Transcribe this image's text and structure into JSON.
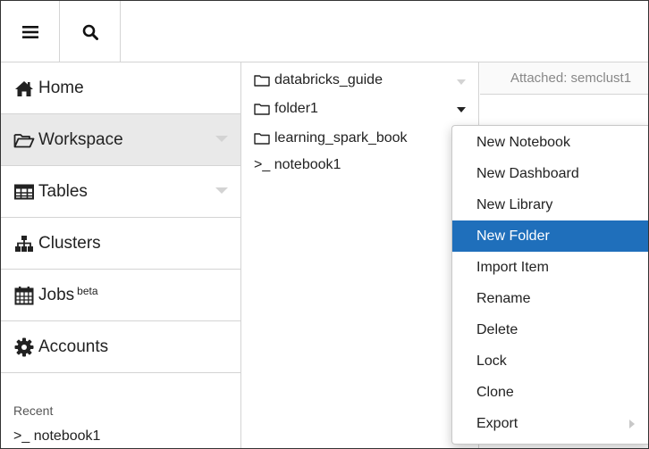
{
  "sidebar": {
    "items": [
      {
        "label": "Home",
        "icon": "home-icon"
      },
      {
        "label": "Workspace",
        "icon": "folder-open-icon"
      },
      {
        "label": "Tables",
        "icon": "table-icon"
      },
      {
        "label": "Clusters",
        "icon": "sitemap-icon"
      },
      {
        "label": "Jobs",
        "badge": "beta",
        "icon": "calendar-icon"
      },
      {
        "label": "Accounts",
        "icon": "gear-icon"
      }
    ],
    "recent_label": "Recent",
    "recent_items": [
      {
        "label": ">_ notebook1"
      }
    ]
  },
  "browser": {
    "items": [
      {
        "label": "databricks_guide",
        "type": "folder"
      },
      {
        "label": "folder1",
        "type": "folder"
      },
      {
        "label": "learning_spark_book",
        "type": "folder"
      },
      {
        "label": ">_ notebook1",
        "type": "notebook"
      }
    ]
  },
  "header": {
    "attached_text": "Attached: semclust1"
  },
  "context_menu": {
    "items": [
      {
        "label": "New Notebook"
      },
      {
        "label": "New Dashboard"
      },
      {
        "label": "New Library"
      },
      {
        "label": "New Folder",
        "highlighted": true
      },
      {
        "label": "Import Item"
      },
      {
        "label": "Rename"
      },
      {
        "label": "Delete"
      },
      {
        "label": "Lock"
      },
      {
        "label": "Clone"
      },
      {
        "label": "Export",
        "has_submenu": true
      }
    ]
  },
  "colors": {
    "highlight": "#1f6fbb",
    "active_nav": "#e9e9e9",
    "border": "#d4d4d4"
  }
}
